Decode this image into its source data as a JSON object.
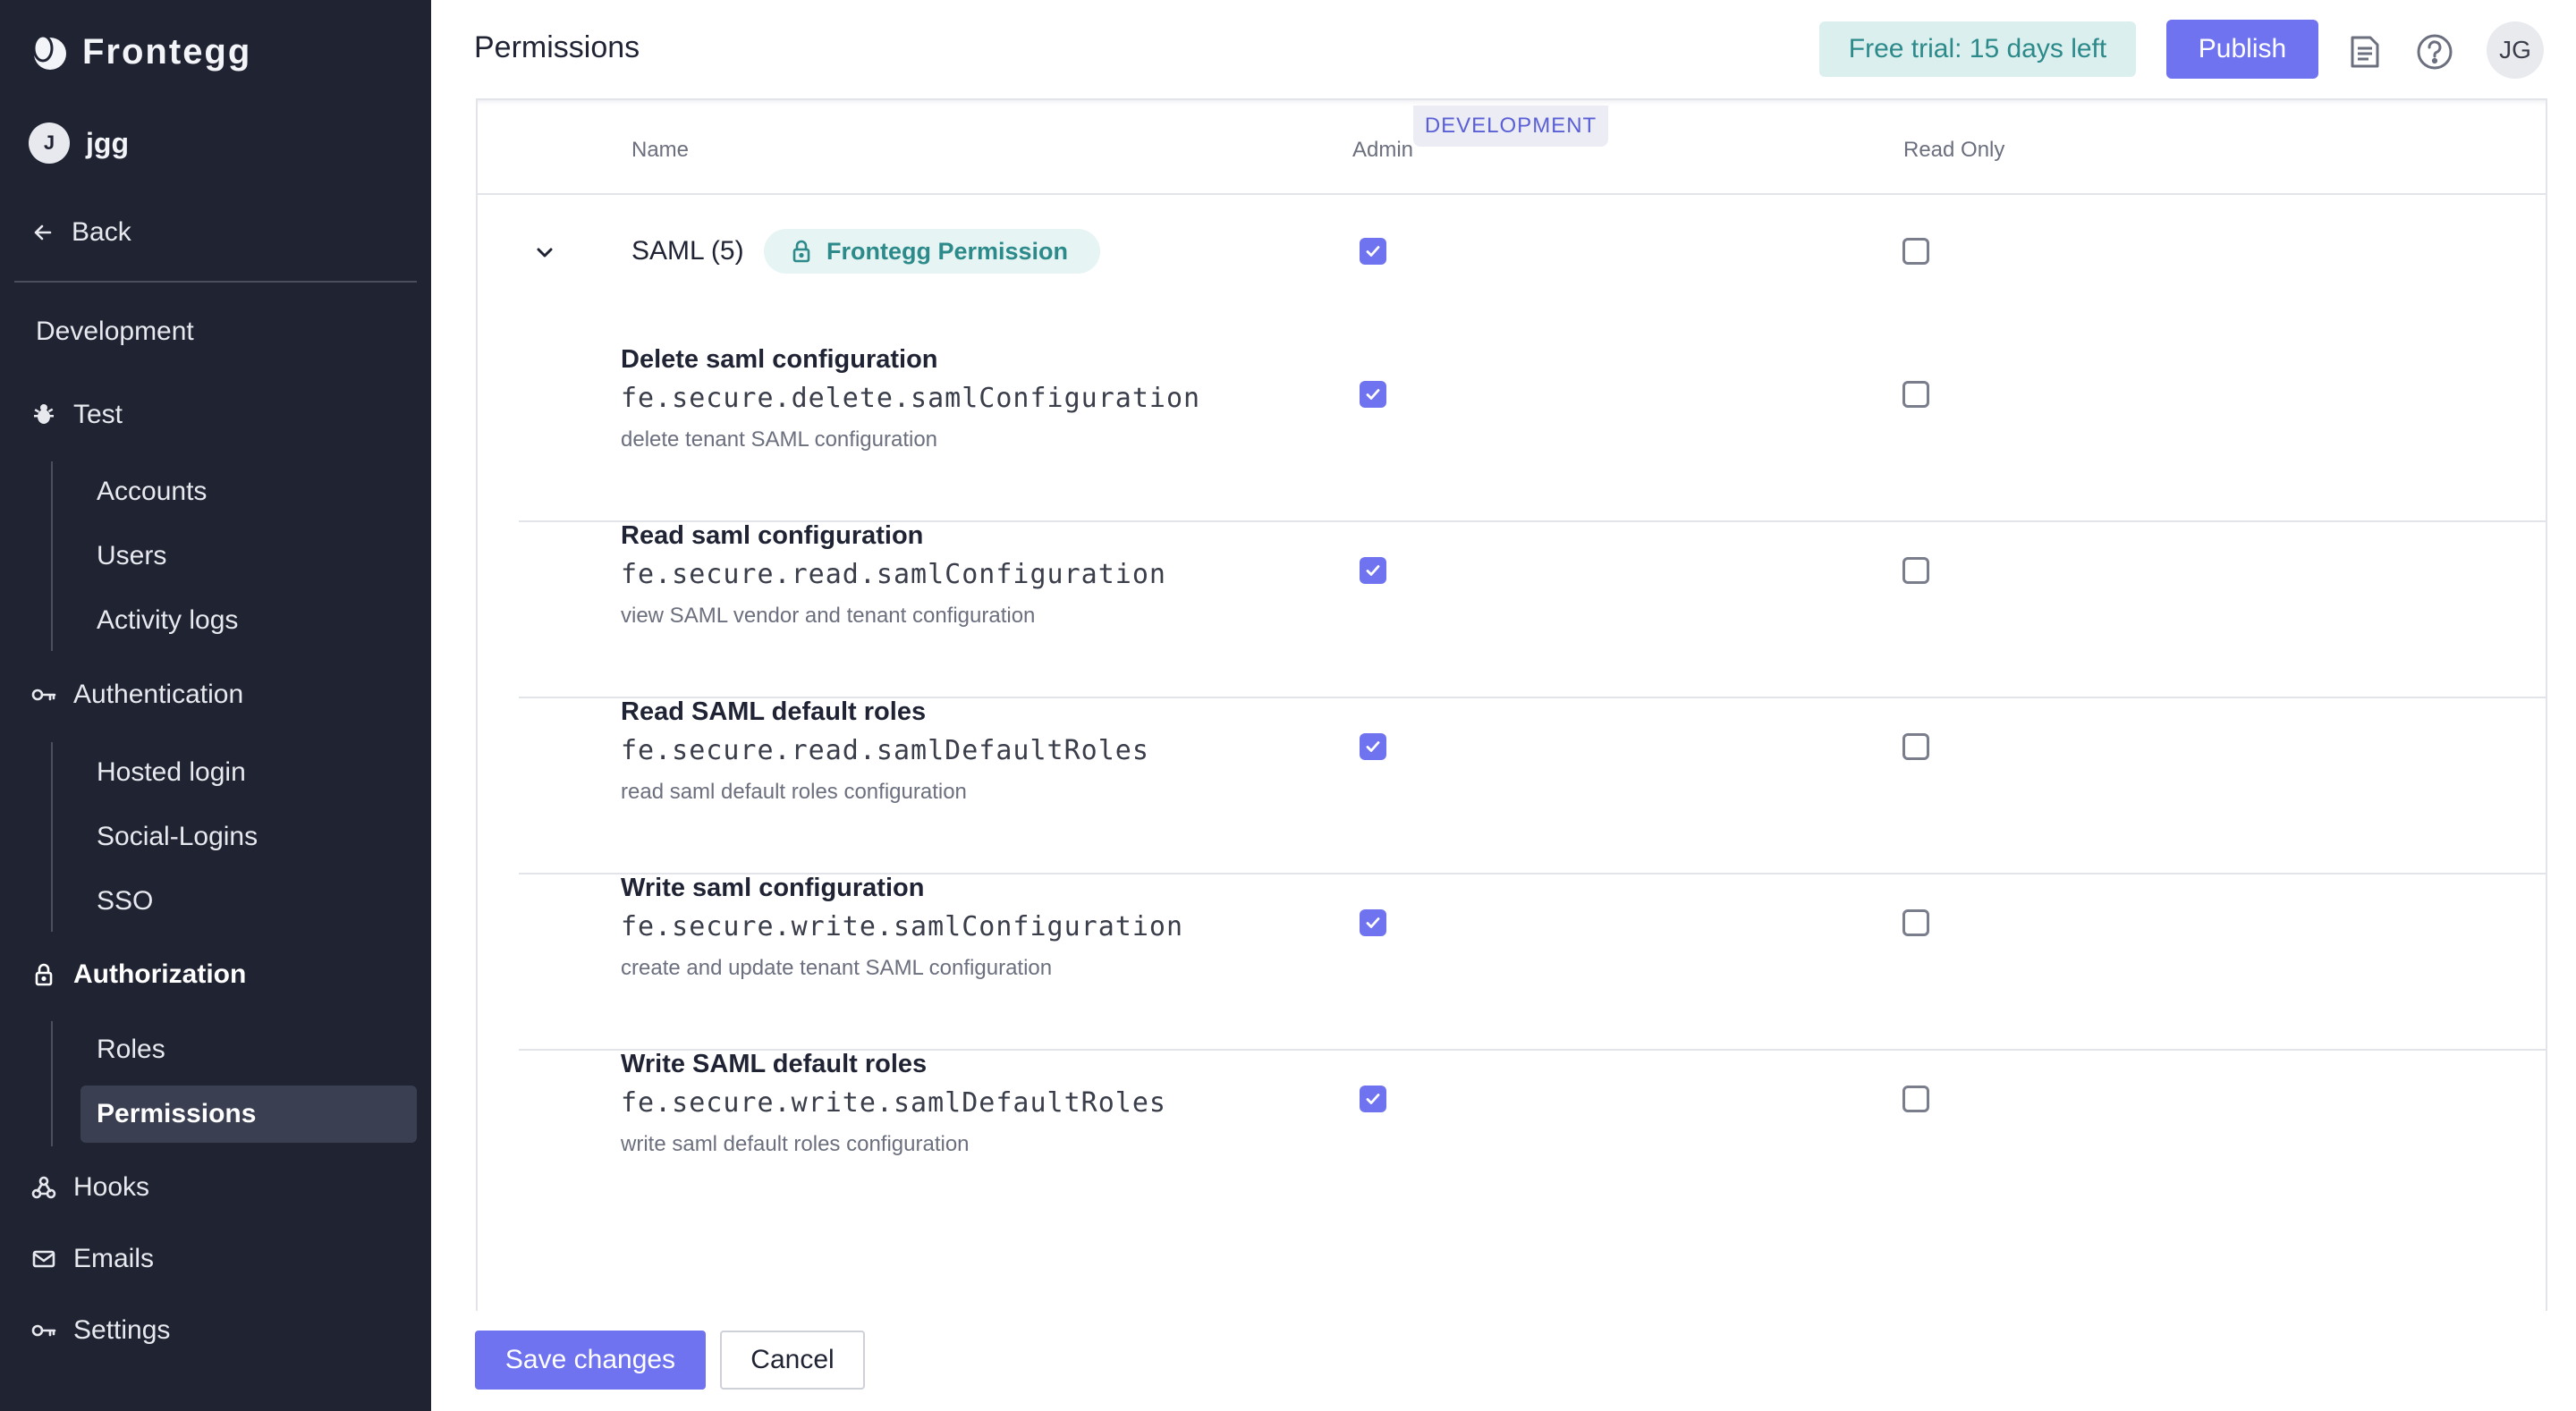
{
  "sidebar": {
    "brand": "Frontegg",
    "user": {
      "initial": "J",
      "name": "jgg"
    },
    "back_label": "Back",
    "environment_label": "Development",
    "groups": [
      {
        "label": "Test",
        "icon": "bug-icon",
        "items": [
          "Accounts",
          "Users",
          "Activity logs"
        ]
      },
      {
        "label": "Authentication",
        "icon": "key-icon",
        "items": [
          "Hosted login",
          "Social-Logins",
          "SSO"
        ]
      },
      {
        "label": "Authorization",
        "icon": "lock-icon",
        "items": [
          "Roles",
          "Permissions"
        ],
        "active": true,
        "selected_item": "Permissions"
      },
      {
        "label": "Hooks",
        "icon": "webhook-icon",
        "items": []
      },
      {
        "label": "Emails",
        "icon": "mail-icon",
        "items": []
      },
      {
        "label": "Settings",
        "icon": "key-icon",
        "items": []
      }
    ]
  },
  "header": {
    "title": "Permissions",
    "trial_badge": "Free trial: 15 days left",
    "publish_label": "Publish",
    "avatar_initials": "JG",
    "icons": [
      "docs-icon",
      "help-icon"
    ]
  },
  "table": {
    "environment_tab": "DEVELOPMENT",
    "columns": {
      "name": "Name",
      "admin": "Admin",
      "read_only": "Read Only"
    },
    "group": {
      "name": "SAML (5)",
      "badge": "Frontegg Permission",
      "admin_checked": true,
      "read_only_checked": false
    },
    "rows": [
      {
        "title": "Delete saml configuration",
        "key": "fe.secure.delete.samlConfiguration",
        "description": "delete tenant SAML configuration",
        "admin": true,
        "read_only": false
      },
      {
        "title": "Read saml configuration",
        "key": "fe.secure.read.samlConfiguration",
        "description": "view SAML vendor and tenant configuration",
        "admin": true,
        "read_only": false
      },
      {
        "title": "Read SAML default roles",
        "key": "fe.secure.read.samlDefaultRoles",
        "description": "read saml default roles configuration",
        "admin": true,
        "read_only": false
      },
      {
        "title": "Write saml configuration",
        "key": "fe.secure.write.samlConfiguration",
        "description": "create and update tenant SAML configuration",
        "admin": true,
        "read_only": false
      },
      {
        "title": "Write SAML default roles",
        "key": "fe.secure.write.samlDefaultRoles",
        "description": "write saml default roles configuration",
        "admin": true,
        "read_only": false
      }
    ]
  },
  "footer": {
    "save_label": "Save changes",
    "cancel_label": "Cancel"
  },
  "colors": {
    "sidebar_bg": "#1f2332",
    "accent": "#6f73ef",
    "trial_bg": "#dcefef",
    "trial_text": "#2c8a8a"
  }
}
